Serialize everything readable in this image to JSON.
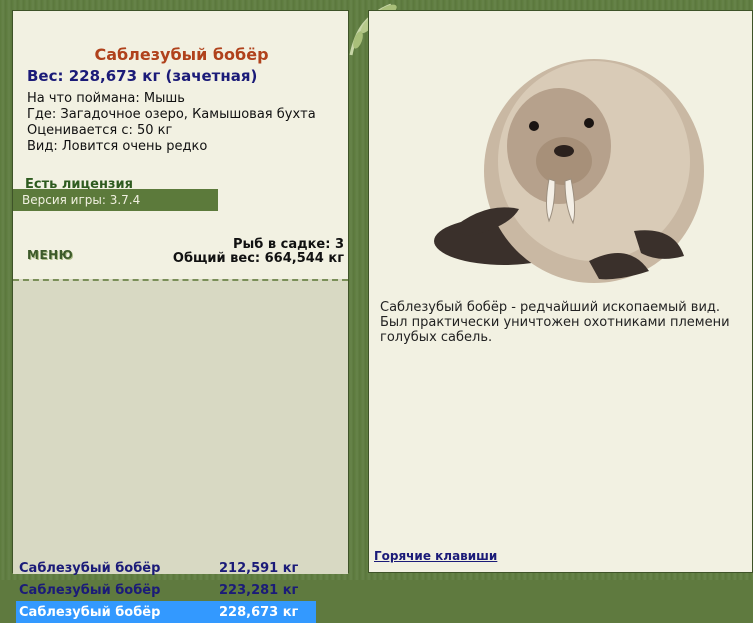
{
  "left_panel": {
    "fish_name": "Саблезубый бобёр",
    "weight_line": "Вес: 228,673 кг (зачетная)",
    "bait_line": "На что поймана: Мышь",
    "location_line": "Где: Загадочное озеро, Камышовая бухта",
    "valued_line": "Оценивается с: 50 кг",
    "rarity_line": "Вид: Ловится очень редко",
    "license_text": "Есть лицензия",
    "version_text": "Версия игры: 3.7.4",
    "menu_label": "МЕНЮ",
    "keep_count_text": "Рыб в садке: 3",
    "keep_total_text": "Общий вес: 664,544 кг"
  },
  "fish_list": [
    {
      "name": "Саблезубый бобёр",
      "weight": "212,591 кг",
      "selected": false
    },
    {
      "name": "Саблезубый бобёр",
      "weight": "223,281 кг",
      "selected": false
    },
    {
      "name": "Саблезубый бобёр",
      "weight": "228,673 кг",
      "selected": true
    }
  ],
  "right_panel": {
    "description": "Саблезубый бобёр - редчайший ископаемый вид. Был практически уничтожен охотниками племени голубых сабель.",
    "hotkeys_link": "Горячие клавиши",
    "image_icon": "sabretooth-beaver-image"
  },
  "colors": {
    "frame_green": "#5f7a3f",
    "panel_bg": "#f2f1e2",
    "title_orange": "#b0421c",
    "text_navy": "#1b1b78",
    "selected_blue": "#3399ff"
  }
}
